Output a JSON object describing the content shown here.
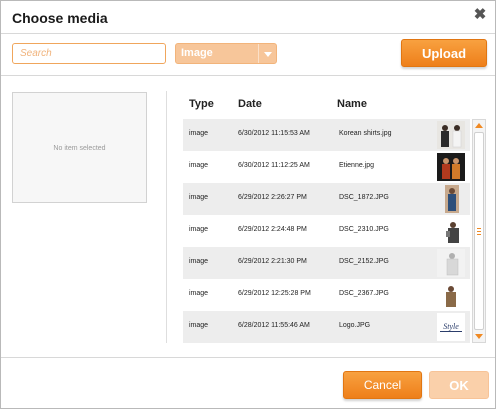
{
  "dialog": {
    "title": "Choose media"
  },
  "toolbar": {
    "search_placeholder": "Search",
    "filter_selected": "Image",
    "upload_label": "Upload"
  },
  "preview": {
    "empty_text": "No item selected"
  },
  "table": {
    "headers": {
      "type": "Type",
      "date": "Date",
      "name": "Name"
    },
    "rows": [
      {
        "type": "image",
        "date": "6/30/2012 11:15:53 AM",
        "name": "Korean shirts.jpg"
      },
      {
        "type": "image",
        "date": "6/30/2012 11:12:25 AM",
        "name": "Etienne.jpg"
      },
      {
        "type": "image",
        "date": "6/29/2012 2:26:27 PM",
        "name": "DSC_1872.JPG"
      },
      {
        "type": "image",
        "date": "6/29/2012 2:24:48 PM",
        "name": "DSC_2310.JPG"
      },
      {
        "type": "image",
        "date": "6/29/2012 2:21:30 PM",
        "name": "DSC_2152.JPG"
      },
      {
        "type": "image",
        "date": "6/29/2012 12:25:28 PM",
        "name": "DSC_2367.JPG"
      },
      {
        "type": "image",
        "date": "6/28/2012 11:55:46 AM",
        "name": "Logo.JPG"
      }
    ],
    "thumb_logo_text": "Style"
  },
  "footer": {
    "cancel_label": "Cancel",
    "ok_label": "OK"
  },
  "colors": {
    "accent": "#f08a24",
    "accent_disabled": "#fad0aa",
    "row_shade": "#ededed"
  }
}
